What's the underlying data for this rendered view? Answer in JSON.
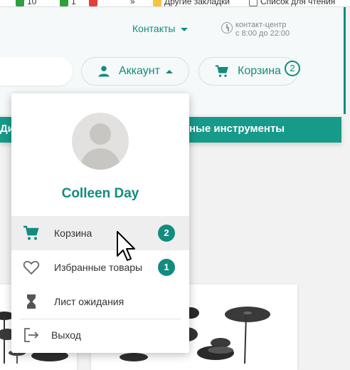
{
  "browser": {
    "bookmarks": [
      {
        "label": "10",
        "color": "#2e9e3e"
      },
      {
        "label": "1",
        "color": "#2e9e3e"
      },
      {
        "label": "",
        "color": "#e2413b"
      }
    ],
    "overflow": "»",
    "other_bookmarks": "Другие закладки",
    "reading_list": "Список для чтения"
  },
  "header": {
    "contacts_label": "Контакты",
    "contact_center": "контакт-центр",
    "hours": "с 8:00 до 22:00",
    "account_label": "Аккаунт",
    "cart_label": "Корзина",
    "cart_count": "2"
  },
  "nav": {
    "left_text": "Ди",
    "right_text": "ные инструменты"
  },
  "menu": {
    "user_name": "Colleen Day",
    "items": [
      {
        "icon": "cart-icon",
        "label": "Корзина",
        "count": "2"
      },
      {
        "icon": "heart-icon",
        "label": "Избранные товары",
        "count": "1"
      },
      {
        "icon": "hourglass-icon",
        "label": "Лист ожидания"
      },
      {
        "icon": "logout-icon",
        "label": "Выход"
      }
    ]
  },
  "colors": {
    "accent": "#128c7e",
    "nav_bar": "#169a8a"
  }
}
